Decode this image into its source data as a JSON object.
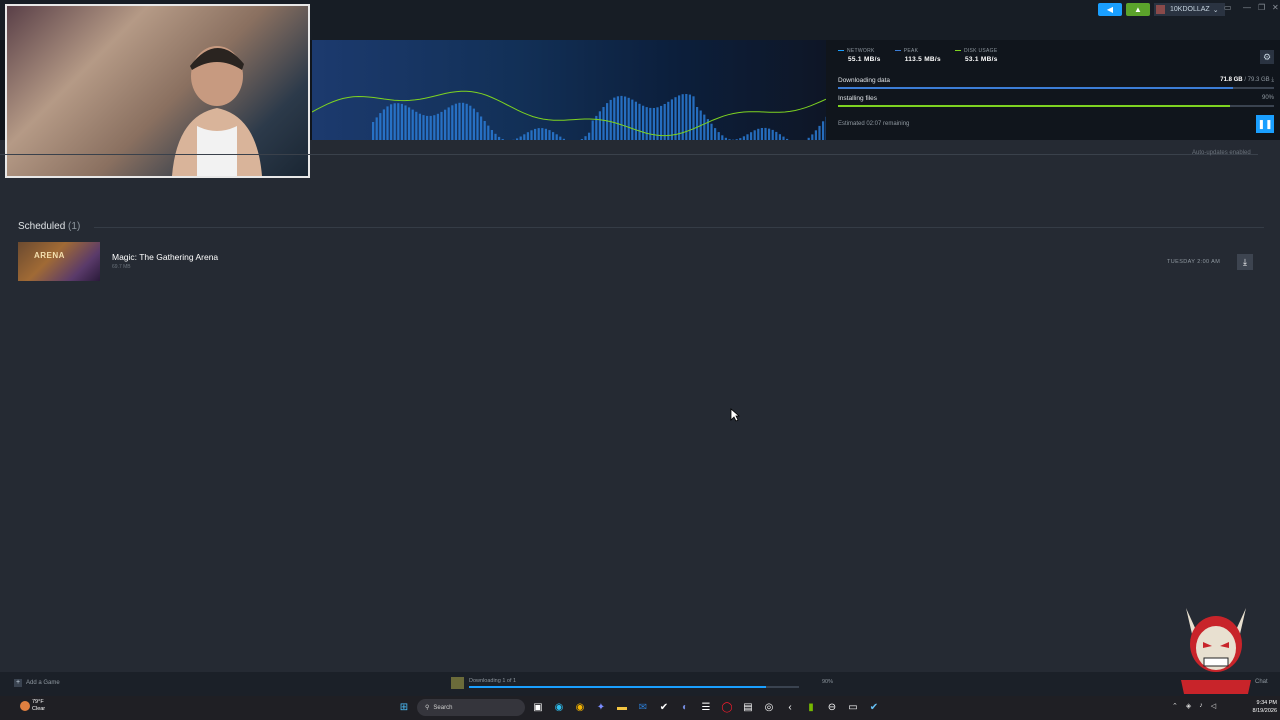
{
  "titlebar": {
    "username": "10KDOLLAZ",
    "username_caret": "⌄",
    "buttons": {
      "broadcast_icon": "megaphone-icon",
      "notifications_icon": "bell-icon"
    },
    "window_controls": [
      "▭",
      "—",
      "❐",
      "✕"
    ]
  },
  "download_header": {
    "stats": [
      {
        "label": "NETWORK",
        "value": "55.1 MB/s",
        "color": "#1a9fff"
      },
      {
        "label": "PEAK",
        "value": "113.5 MB/s",
        "color": "#3c7dd6"
      },
      {
        "label": "DISK USAGE",
        "value": "53.1 MB/s",
        "color": "#7ed321"
      }
    ],
    "downloading_label": "Downloading data",
    "downloading_value": "71.8 GB",
    "downloading_total": " / 79.3 GB",
    "downloading_fraction": 0.905,
    "installing_label": "Installing files",
    "installing_pct": "90%",
    "installing_fraction": 0.9,
    "eta": "Estimated 02:07 remaining",
    "pause_glyph": "❚❚",
    "gear_glyph": "⚙",
    "download_glyph": "⤓"
  },
  "auto_updates": "Auto-updates enabled",
  "scheduled": {
    "title": "Scheduled",
    "count": "(1)",
    "items": [
      {
        "name": "Magic: The Gathering Arena",
        "size": "69.7 MB",
        "time": "TUESDAY 2:00 AM",
        "thumb_text": "ARENA",
        "download_glyph": "⤓"
      }
    ]
  },
  "bottom_bar": {
    "add_game": "Add a Game",
    "add_glyph": "+",
    "downloading": "Downloading 1 of 1",
    "pct": "90%",
    "fraction": 0.9,
    "chat": "Chat"
  },
  "taskbar": {
    "weather_temp": "79°F",
    "weather_desc": "Clear",
    "search": "Search",
    "time": "9:34 PM",
    "date": "8/19/2026",
    "apps": [
      "windows-start-icon",
      "search-box",
      "task-view-icon",
      "edge-icon",
      "chrome-icon",
      "copilot-icon",
      "file-explorer-icon",
      "outlook-icon",
      "steam-icon",
      "discord-icon",
      "obs-icon",
      "opera-icon",
      "elgato-icon",
      "streamlabs-icon",
      "back-icon",
      "nvidia-icon",
      "settings-icon",
      "terminal-icon",
      "steam-active-icon"
    ]
  },
  "colors": {
    "accent": "#1a9fff",
    "green": "#7ed321",
    "background": "#252a33"
  }
}
